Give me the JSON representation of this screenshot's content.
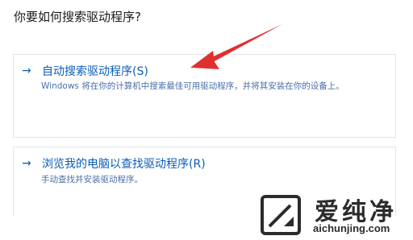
{
  "dialog": {
    "question": "你要如何搜索驱动程序?",
    "options": [
      {
        "arrow": "→",
        "title": "自动搜索驱动程序(S)",
        "description": "Windows 将在你的计算机中搜索最佳可用驱动程序，并将其安装在你的设备上。"
      },
      {
        "arrow": "→",
        "title": "浏览我的电脑以查找驱动程序(R)",
        "description": "手动查找并安装驱动程序。"
      }
    ]
  },
  "annotation": {
    "arrow_color": "#e0312f"
  },
  "watermark": {
    "brand": "爱纯净",
    "url": "aichunjing.com"
  },
  "colors": {
    "link_blue": "#0b5db8",
    "desc_blue": "#4a6fa8",
    "card_border": "#e3e6ea"
  }
}
